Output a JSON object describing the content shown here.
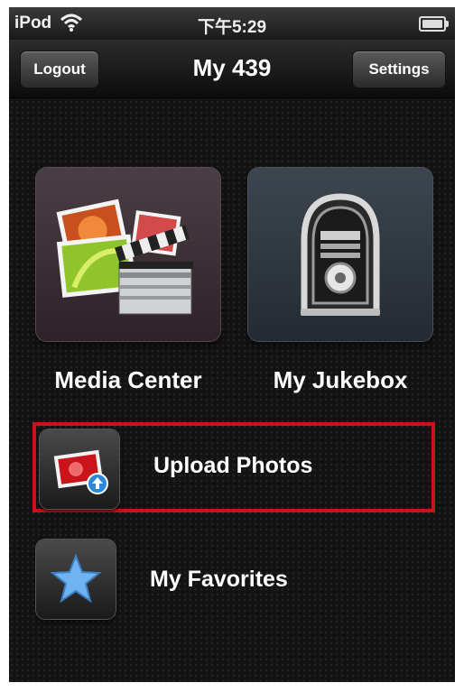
{
  "status_bar": {
    "carrier": "iPod",
    "time": "下午5:29"
  },
  "nav": {
    "title": "My 439",
    "left_button": "Logout",
    "right_button": "Settings"
  },
  "tiles": [
    {
      "label": "Media Center",
      "icon": "media-center-icon"
    },
    {
      "label": "My Jukebox",
      "icon": "jukebox-icon"
    }
  ],
  "list": [
    {
      "label": "Upload Photos",
      "icon": "upload-photo-icon",
      "highlighted": true
    },
    {
      "label": "My Favorites",
      "icon": "star-icon",
      "highlighted": false
    }
  ],
  "colors": {
    "highlight_border": "#c8141a",
    "background": "#131313",
    "star": "#6fb3f0"
  }
}
